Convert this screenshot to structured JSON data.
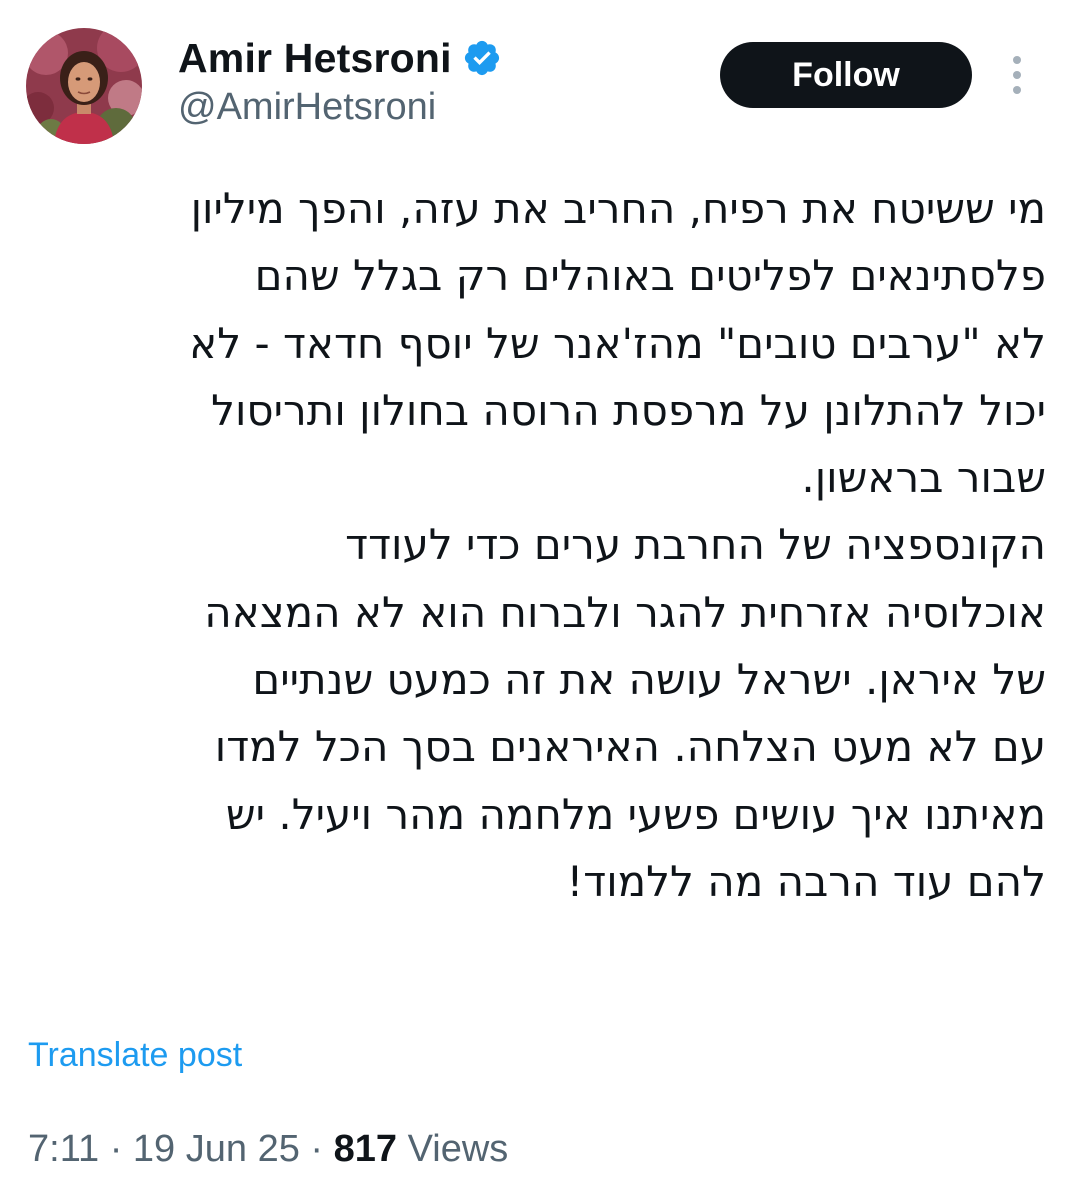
{
  "author": {
    "display_name": "Amir Hetsroni",
    "handle": "@AmirHetsroni",
    "verified_icon": "verified-badge-icon",
    "avatar_icon": "profile-photo"
  },
  "actions": {
    "follow_label": "Follow",
    "more_icon": "more-vertical-icon"
  },
  "tweet": {
    "lines": [
      "מי ששיטח את רפיח, החריב את עזה, והפך מיליון",
      "פלסתינאים לפליטים באוהלים רק בגלל שהם",
      "לא \"ערבים טובים\" מהז'אנר של יוסף חדאד - לא",
      "יכול להתלונן על מרפסת הרוסה בחולון ותריסול",
      "שבור בראשון.",
      "הקונספציה של החרבת ערים כדי לעודד",
      "אוכלוסיה אזרחית להגר ולברוח הוא לא המצאה",
      "של איראן. ישראל עושה את זה כמעט שנתיים",
      "עם לא מעט הצלחה. האיראנים בסך הכל למדו",
      "מאיתנו איך עושים פשעי מלחמה מהר ויעיל. יש",
      "להם עוד הרבה מה ללמוד!"
    ],
    "translate_label": "Translate post"
  },
  "meta": {
    "time": "7:11",
    "separator": "·",
    "date": "19 Jun 25",
    "views_count": "817",
    "views_label": "Views"
  },
  "colors": {
    "text": "#0f1419",
    "secondary": "#536471",
    "link": "#1d9bf0",
    "verified": "#1d9bf0",
    "button_bg": "#0f1419",
    "button_text": "#ffffff"
  }
}
